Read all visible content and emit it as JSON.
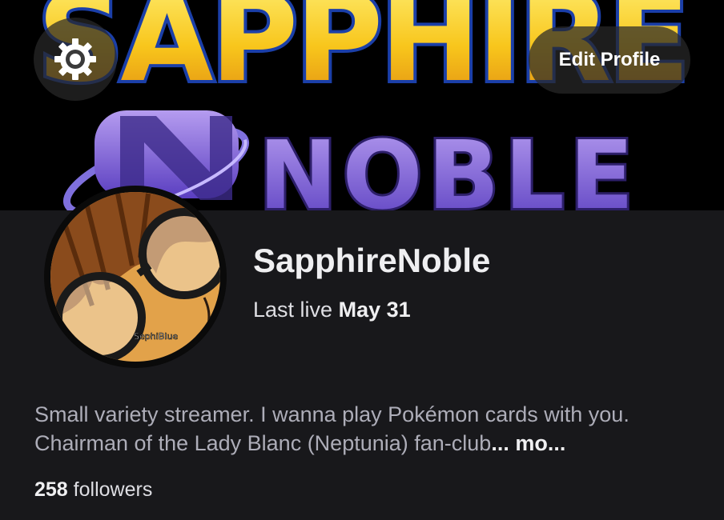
{
  "banner": {
    "top_text": "SAPPHIRE",
    "bottom_text": "NOBLE"
  },
  "header": {
    "settings_icon": "gear-icon",
    "edit_profile_label": "Edit Profile"
  },
  "profile": {
    "username": "SapphireNoble",
    "last_live_prefix": "Last live",
    "last_live_date": "May 31",
    "avatar_signature": "SephiBlue",
    "bio_text": "Small variety streamer. I wanna play Pokémon cards with you. Chairman of the Lady Blanc (Neptunia) fan-club",
    "bio_more": "... mo...",
    "followers_count": "258",
    "followers_label": "followers"
  },
  "colors": {
    "background": "#18181b",
    "banner_text_yellow": "#f7c31c",
    "banner_text_purple": "#8a6ad8",
    "accent_text": "#efeff1"
  }
}
